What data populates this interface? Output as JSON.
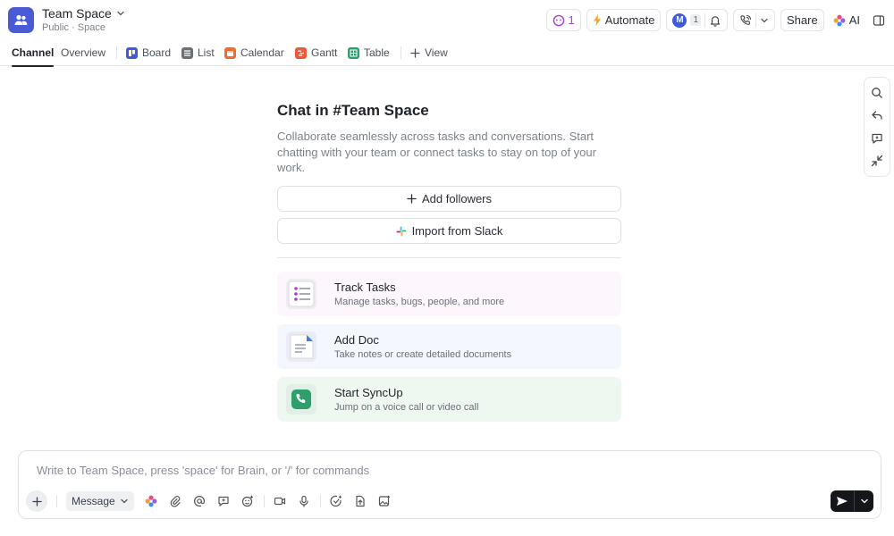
{
  "header": {
    "space_name": "Team Space",
    "visibility": "Public",
    "space_type": "Space",
    "dot": "·",
    "inbox_count": "1",
    "automate_label": "Automate",
    "member_initial": "M",
    "member_count": "1",
    "share_label": "Share",
    "ai_label": "AI"
  },
  "tabs": [
    {
      "label": "Channel"
    },
    {
      "label": "Overview"
    },
    {
      "label": "Board"
    },
    {
      "label": "List"
    },
    {
      "label": "Calendar"
    },
    {
      "label": "Gantt"
    },
    {
      "label": "Table"
    },
    {
      "label": "View"
    }
  ],
  "main": {
    "title": "Chat in #Team Space",
    "description": "Collaborate seamlessly across tasks and conversations. Start chatting with your team or connect tasks to stay on top of your work.",
    "add_followers": "Add followers",
    "import_slack": "Import from Slack",
    "cards": [
      {
        "title": "Track Tasks",
        "subtitle": "Manage tasks, bugs, people, and more",
        "bg": "#fdf6fc"
      },
      {
        "title": "Add Doc",
        "subtitle": "Take notes or create detailed documents",
        "bg": "#f4f7fd"
      },
      {
        "title": "Start SyncUp",
        "subtitle": "Jump on a voice call or video call",
        "bg": "#eef8f1"
      }
    ]
  },
  "composer": {
    "placeholder": "Write to Team Space, press 'space' for Brain, or '/' for commands",
    "message_type": "Message"
  },
  "colors": {
    "brand": "#4a5bd6",
    "automate": "#f5a524",
    "calendar": "#f26a2e",
    "gantt": "#ea5a3c",
    "table": "#2e9f6b",
    "board": "#3b5bdb",
    "send": "#14161a"
  }
}
